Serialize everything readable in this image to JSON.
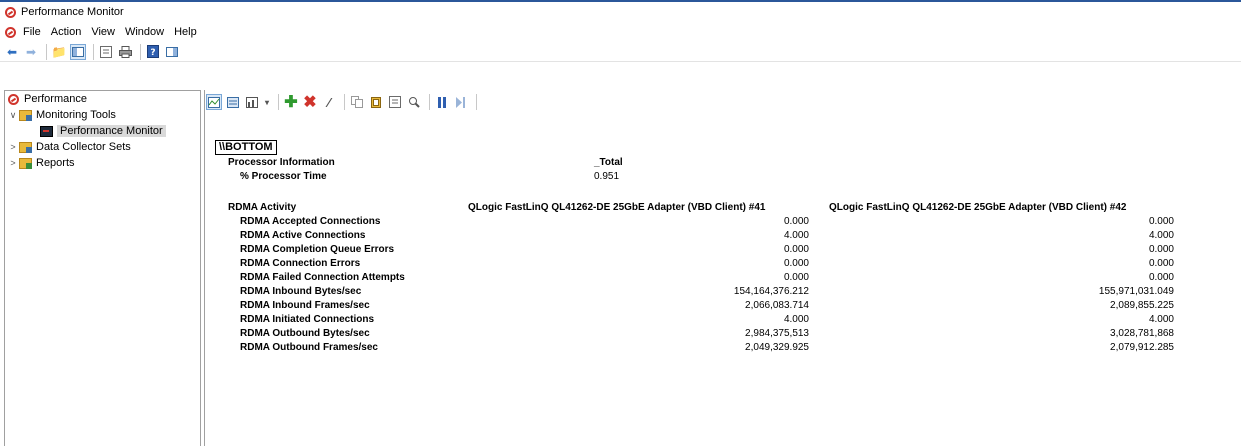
{
  "window": {
    "title": "Performance Monitor"
  },
  "menu": [
    "File",
    "Action",
    "View",
    "Window",
    "Help"
  ],
  "toolbar_icons": [
    "back-arrow-icon",
    "forward-arrow-icon",
    "up-folder-icon",
    "show-hide-tree-icon",
    "properties-icon",
    "print-icon",
    "help-icon",
    "export-list-icon"
  ],
  "tree": {
    "root": "Performance",
    "monitoring_tools": "Monitoring Tools",
    "performance_monitor": "Performance Monitor",
    "data_collector_sets": "Data Collector Sets",
    "reports": "Reports"
  },
  "report": {
    "machine": "\\\\BOTTOM",
    "processor_object": "Processor Information",
    "processor_instance": "_Total",
    "processor_counter": "% Processor Time",
    "processor_value": "0.951",
    "rdma_object": "RDMA Activity",
    "rdma_instances": [
      "QLogic FastLinQ QL41262-DE 25GbE Adapter (VBD Client) #41",
      "QLogic FastLinQ QL41262-DE 25GbE Adapter (VBD Client) #42"
    ],
    "rdma_rows": [
      {
        "counter": "RDMA Accepted Connections",
        "v1": "0.000",
        "v2": "0.000"
      },
      {
        "counter": "RDMA Active Connections",
        "v1": "4.000",
        "v2": "4.000"
      },
      {
        "counter": "RDMA Completion Queue Errors",
        "v1": "0.000",
        "v2": "0.000"
      },
      {
        "counter": "RDMA Connection Errors",
        "v1": "0.000",
        "v2": "0.000"
      },
      {
        "counter": "RDMA Failed Connection Attempts",
        "v1": "0.000",
        "v2": "0.000"
      },
      {
        "counter": "RDMA Inbound Bytes/sec",
        "v1": "154,164,376.212",
        "v2": "155,971,031.049"
      },
      {
        "counter": "RDMA Inbound Frames/sec",
        "v1": "2,066,083.714",
        "v2": "2,089,855.225"
      },
      {
        "counter": "RDMA Initiated Connections",
        "v1": "4.000",
        "v2": "4.000"
      },
      {
        "counter": "RDMA Outbound Bytes/sec",
        "v1": "2,984,375,513",
        "v2": "3,028,781,868"
      },
      {
        "counter": "RDMA Outbound Frames/sec",
        "v1": "2,049,329.925",
        "v2": "2,079,912.285"
      }
    ]
  }
}
